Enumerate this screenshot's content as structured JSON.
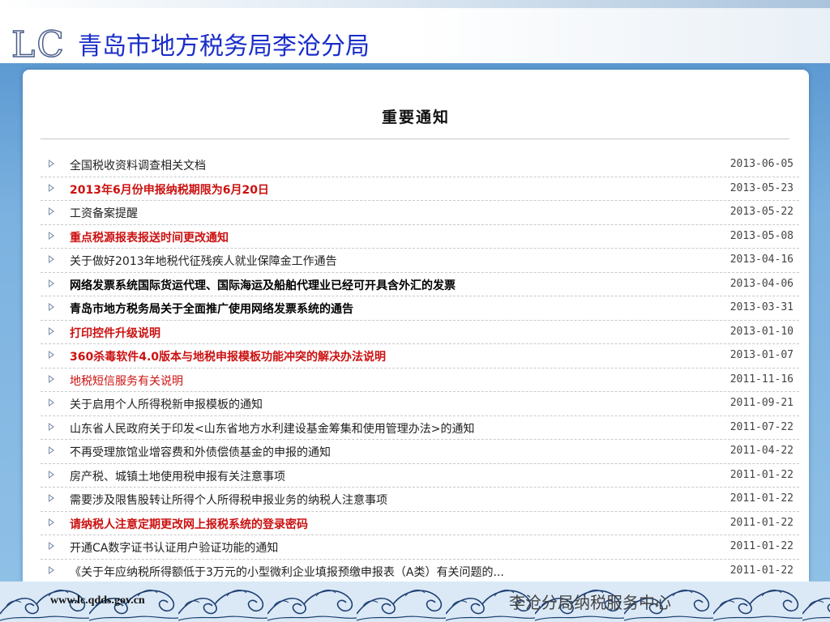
{
  "header": {
    "logo_text": "LC",
    "org_title": "青岛市地方税务局李沧分局"
  },
  "panel": {
    "title": "重要通知"
  },
  "notices": [
    {
      "text": "全国税收资料调查相关文档",
      "date": "2013-06-05",
      "style": "normal"
    },
    {
      "text": "2013年6月份申报纳税期限为6月20日",
      "date": "2013-05-23",
      "style": "red"
    },
    {
      "text": "工资备案提醒",
      "date": "2013-05-22",
      "style": "normal"
    },
    {
      "text": "重点税源报表报送时间更改通知",
      "date": "2013-05-08",
      "style": "red"
    },
    {
      "text": "关于做好2013年地税代征残疾人就业保障金工作通告",
      "date": "2013-04-16",
      "style": "normal"
    },
    {
      "text": "网络发票系统国际货运代理、国际海运及船舶代理业已经可开具含外汇的发票",
      "date": "2013-04-06",
      "style": "bold"
    },
    {
      "text": "青岛市地方税务局关于全面推广使用网络发票系统的通告",
      "date": "2013-03-31",
      "style": "bold"
    },
    {
      "text": "打印控件升级说明",
      "date": "2013-01-10",
      "style": "red"
    },
    {
      "text": "360杀毒软件4.0版本与地税申报模板功能冲突的解决办法说明",
      "date": "2013-01-07",
      "style": "red"
    },
    {
      "text": "地税短信服务有关说明",
      "date": "2011-11-16",
      "style": "plainred"
    },
    {
      "text": "关于启用个人所得税新申报模板的通知",
      "date": "2011-09-21",
      "style": "normal"
    },
    {
      "text": "山东省人民政府关于印发<山东省地方水利建设基金筹集和使用管理办法>的通知",
      "date": "2011-07-22",
      "style": "normal"
    },
    {
      "text": "不再受理旅馆业增容费和外债偿债基金的申报的通知",
      "date": "2011-04-22",
      "style": "normal"
    },
    {
      "text": "房产税、城镇土地使用税申报有关注意事项",
      "date": "2011-01-22",
      "style": "normal"
    },
    {
      "text": "需要涉及限售股转让所得个人所得税申报业务的纳税人注意事项",
      "date": "2011-01-22",
      "style": "normal"
    },
    {
      "text": "请纳税人注意定期更改网上报税系统的登录密码",
      "date": "2011-01-22",
      "style": "red"
    },
    {
      "text": "开通CA数字证书认证用户验证功能的通知",
      "date": "2011-01-22",
      "style": "normal"
    },
    {
      "text": "《关于年应纳税所得额低于3万元的小型微利企业填报预缴申报表（A类）有关问题的...",
      "date": "2011-01-22",
      "style": "normal"
    }
  ],
  "footer": {
    "url": "www.lc.qdds.gov.cn",
    "center_text": "李沧分局纳税服务中心"
  },
  "colors": {
    "title_blue": "#1a2ec9",
    "highlight_red": "#cc1111",
    "frame_blue": "#7cb2e0",
    "footer_bg": "#dbe9f6",
    "wave_stroke": "#1e3f73"
  },
  "icons": {
    "list_bullet": "triangle-arrow-right-icon",
    "footer_decoration": "wave-pattern"
  }
}
